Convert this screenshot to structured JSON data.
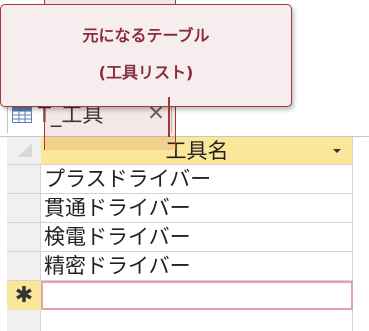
{
  "callout": {
    "line1": "元になるテーブル",
    "line2": "(工具リスト)"
  },
  "tab": {
    "title": "T_工具",
    "close_glyph": "✕",
    "icon": "table-icon"
  },
  "datasheet": {
    "column_header": "工具名",
    "rows": [
      "プラスドライバー",
      "貫通ドライバー",
      "検電ドライバー",
      "精密ドライバー"
    ],
    "new_record_marker": "✱"
  },
  "colors": {
    "accent": "#a4373a",
    "header_fill": "#fbe79a",
    "callout_fill": "#f6edef",
    "callout_text": "#8b2d3c",
    "new_row_border": "#e8a0a8"
  }
}
